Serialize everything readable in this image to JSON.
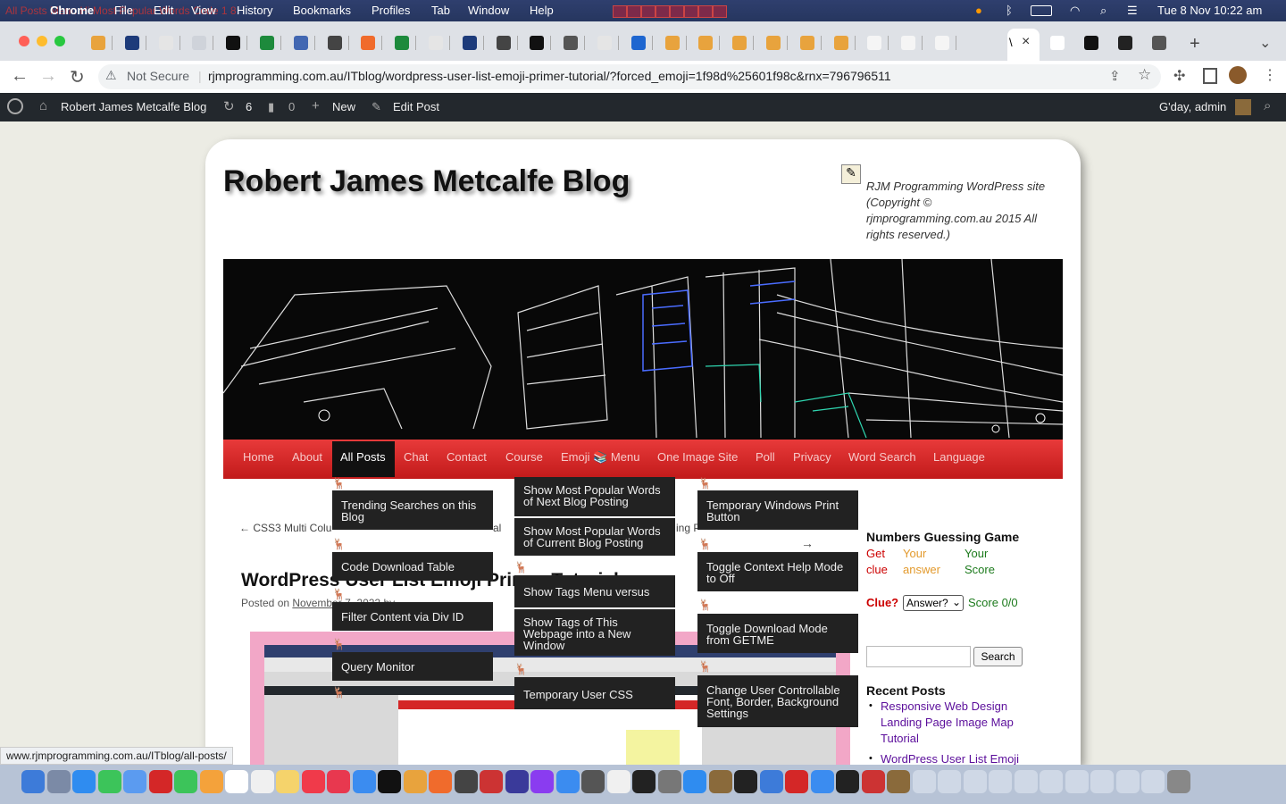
{
  "mac_menubar": {
    "apple_icon": "apple-icon",
    "items": [
      "Chrome",
      "File",
      "Edit",
      "View",
      "History",
      "Bookmarks",
      "Profiles",
      "Tab",
      "Window",
      "Help"
    ],
    "overlay_text": "All Posts Menu Hi Most Popular Words Code 1 8",
    "date_time": "Tue 8 Nov  10:22 am"
  },
  "browser": {
    "active_tab_close": "×",
    "new_tab": "+",
    "tab_dropdown": "⌄",
    "not_secure": "Not Secure",
    "url": "rjmprogramming.com.au/ITblog/wordpress-user-list-emoji-primer-tutorial/?forced_emoji=1f98d%25601f98c&rnx=796796511",
    "status_url": "www.rjmprogramming.com.au/ITblog/all-posts/"
  },
  "admin_bar": {
    "site_name": "Robert James Metcalfe Blog",
    "updates_count": "6",
    "comments_count": "0",
    "new_label": "New",
    "edit_post": "Edit Post",
    "greeting": "G'day, admin"
  },
  "site": {
    "title": "Robert James Metcalfe Blog",
    "tagline": "RJM Programming WordPress site (Copyright © rjmprogramming.com.au 2015 All rights reserved.)"
  },
  "menu": {
    "items": [
      "Home",
      "About",
      "All Posts",
      "Chat",
      "Contact",
      "Course",
      "Emoji 📚 Menu",
      "One Image Site",
      "Poll",
      "Privacy",
      "Word Search",
      "Language"
    ]
  },
  "dropdown": {
    "col1": [
      "Trending Searches on this Blog",
      "Code Download Table",
      "Filter Content via Div ID",
      "Query Monitor"
    ],
    "col2": [
      "Show Most Popular Words of Next Blog Posting",
      "Show Most Popular Words of Current Blog Posting",
      "Show Tags Menu versus",
      "Show Tags of This Webpage into a New Window",
      "Temporary User CSS"
    ],
    "col3": [
      "Temporary Windows Print Button",
      "Toggle Context Help Mode to Off",
      "Toggle Download Mode from GETME",
      "Change User Controllable Font, Border, Background Settings"
    ],
    "marker": "🦌"
  },
  "post": {
    "prev_link": "← CSS3 Multi Colu",
    "prev_link_tail": "al",
    "next_fragment": "ing P",
    "next_arrow": "→",
    "title": "WordPress User List Emoji Primer Tutorial",
    "posted_on_prefix": "Posted on ",
    "posted_on_date": "November 7, 2022",
    "posted_on_suffix": " by"
  },
  "sidebar": {
    "game_title": "Numbers Guessing Game",
    "game_cells": [
      "Get clue",
      "Your answer",
      "Your Score"
    ],
    "clue_label": "Clue?",
    "answer_select": "Answer?",
    "score": "Score 0/0",
    "search_button": "Search",
    "recent_title": "Recent Posts",
    "recent_posts": [
      "Responsive Web Design Landing Page Image Map Tutorial",
      "WordPress User List Emoji"
    ]
  },
  "colors": {
    "menu_red": "#d42727",
    "admin_bar": "#23282d",
    "link_purple": "#5b0e9b"
  }
}
